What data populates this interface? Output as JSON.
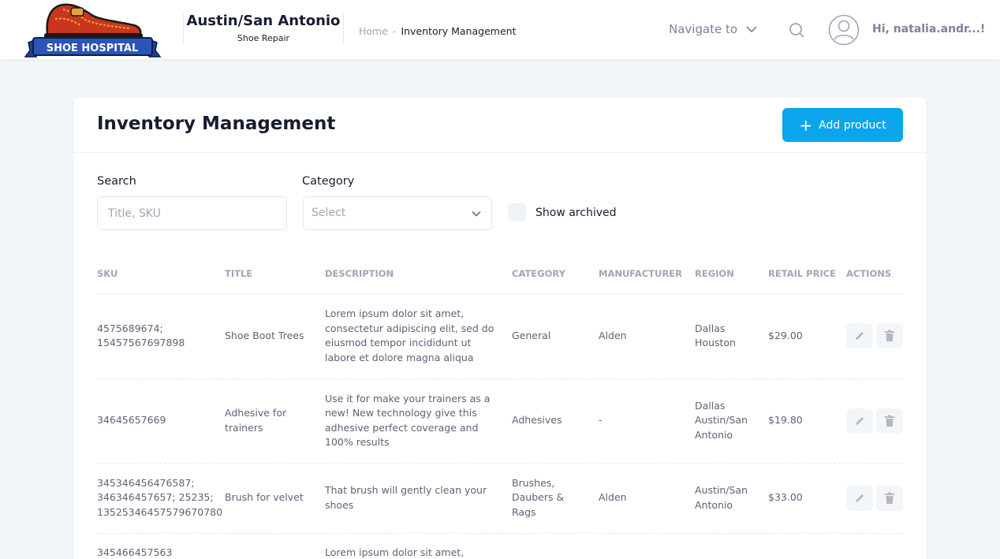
{
  "header": {
    "logo_text": "SHOE HOSPITAL",
    "brand_title": "Austin/San Antonio",
    "brand_subtitle": "Shoe Repair",
    "breadcrumb": {
      "home": "Home",
      "separator": "-",
      "current": "Inventory Management"
    },
    "navigate_label": "Navigate to",
    "greeting": "Hi, natalia.andr...!"
  },
  "page": {
    "title": "Inventory Management",
    "add_button": "Add product"
  },
  "filters": {
    "search_label": "Search",
    "search_placeholder": "Title, SKU",
    "category_label": "Category",
    "category_value": "Select",
    "show_archived_label": "Show archived",
    "show_archived_checked": false
  },
  "table": {
    "columns": [
      "SKU",
      "TITLE",
      "DESCRIPTION",
      "CATEGORY",
      "MANUFACTURER",
      "REGION",
      "RETAIL PRICE",
      "ACTIONS"
    ],
    "rows": [
      {
        "sku": [
          "4575689674;",
          "15457567697898"
        ],
        "title": [
          "Shoe Boot Trees"
        ],
        "description": [
          "Lorem ipsum dolor sit amet,",
          "consectetur adipiscing elit, sed do",
          "eiusmod tempor incididunt ut",
          "labore et dolore magna aliqua"
        ],
        "category": [
          "General"
        ],
        "manufacturer": "Alden",
        "region": [
          "Dallas",
          "Houston"
        ],
        "price": "$29.00"
      },
      {
        "sku": [
          "34645657669"
        ],
        "title": [
          "Adhesive for",
          "trainers"
        ],
        "description": [
          "Use it for make your trainers as a",
          "new! New technology give this",
          "adhesive perfect coverage and",
          "100% results"
        ],
        "category": [
          "Adhesives"
        ],
        "manufacturer": "-",
        "region": [
          "Dallas",
          "Austin/San",
          "Antonio"
        ],
        "price": "$19.80"
      },
      {
        "sku": [
          "345346456476587;",
          "346346457657; 25235;",
          "13525346457579670780"
        ],
        "title": [
          "Brush for velvet"
        ],
        "description": [
          "That brush will gently clean your",
          "shoes"
        ],
        "category": [
          "Brushes,",
          "Daubers &",
          "Rags"
        ],
        "manufacturer": "Alden",
        "region": [
          "Austin/San",
          "Antonio"
        ],
        "price": "$33.00"
      },
      {
        "sku": [
          "345466457563"
        ],
        "title": [
          ""
        ],
        "description": [
          "Lorem ipsum dolor sit amet,"
        ],
        "category": [
          ""
        ],
        "manufacturer": "",
        "region": [
          ""
        ],
        "price": ""
      }
    ],
    "action_icons": [
      "pencil-icon",
      "trash-icon"
    ]
  },
  "colors": {
    "accent": "#0ba5ec",
    "page_bg": "#f3f6f9",
    "text_dark": "#181c32",
    "text_muted": "#a1a5b7"
  }
}
